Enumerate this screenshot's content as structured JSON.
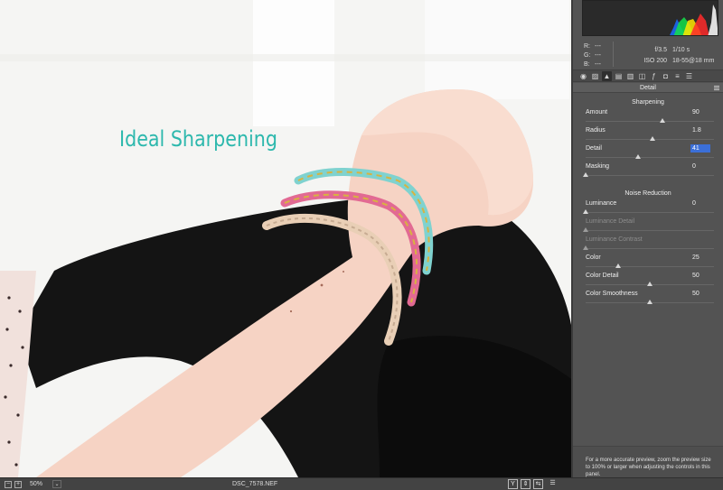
{
  "overlay": {
    "title": "Ideal Sharpening"
  },
  "histogram": {
    "colors": [
      "#1a6bff",
      "#13e04a",
      "#ffe600",
      "#ff2a2a",
      "#ffffff"
    ]
  },
  "info": {
    "r_label": "R:",
    "r_value": "---",
    "g_label": "G:",
    "g_value": "---",
    "b_label": "B:",
    "b_value": "---",
    "aperture": "f/3.5",
    "shutter": "1/10 s",
    "iso": "ISO 200",
    "lens": "18-55@18 mm"
  },
  "tabs": [
    {
      "icon": "basic-aperture-icon",
      "glyph": "◉"
    },
    {
      "icon": "tone-curve-icon",
      "glyph": "▨"
    },
    {
      "icon": "detail-triangle-icon",
      "glyph": "▲"
    },
    {
      "icon": "hsl-icon",
      "glyph": "▤"
    },
    {
      "icon": "split-toning-icon",
      "glyph": "▥"
    },
    {
      "icon": "lens-corrections-icon",
      "glyph": "◫"
    },
    {
      "icon": "effects-fx-icon",
      "glyph": "ƒ"
    },
    {
      "icon": "camera-calibration-icon",
      "glyph": "◘"
    },
    {
      "icon": "presets-icon",
      "glyph": "≡"
    },
    {
      "icon": "snapshots-icon",
      "glyph": "☰"
    }
  ],
  "panel": {
    "section": "Detail"
  },
  "sharpening": {
    "title": "Sharpening",
    "sliders": [
      {
        "label": "Amount",
        "value": "90",
        "position": 0.6
      },
      {
        "label": "Radius",
        "value": "1.8",
        "position": 0.52
      },
      {
        "label": "Detail",
        "value": "41",
        "position": 0.41,
        "selected": true
      },
      {
        "label": "Masking",
        "value": "0",
        "position": 0.0
      }
    ]
  },
  "noise": {
    "title": "Noise Reduction",
    "sliders": [
      {
        "label": "Luminance",
        "value": "0",
        "position": 0.0
      },
      {
        "label": "Luminance Detail",
        "value": "",
        "position": 0.0,
        "disabled": true
      },
      {
        "label": "Luminance Contrast",
        "value": "",
        "position": 0.0,
        "disabled": true
      },
      {
        "label": "Color",
        "value": "25",
        "position": 0.25
      },
      {
        "label": "Color Detail",
        "value": "50",
        "position": 0.5
      },
      {
        "label": "Color Smoothness",
        "value": "50",
        "position": 0.5
      }
    ]
  },
  "hint": "For a more accurate preview, zoom the preview size to 100% or larger when adjusting the controls in this panel.",
  "status": {
    "zoom_out": "−",
    "zoom_in": "+",
    "zoom_level": "50%",
    "zoom_arrow": "⌄",
    "filename": "DSC_7578.NEF",
    "view_y": "Y",
    "view_split": "⇕",
    "view_swap": "⇆",
    "view_settings": "☰"
  }
}
